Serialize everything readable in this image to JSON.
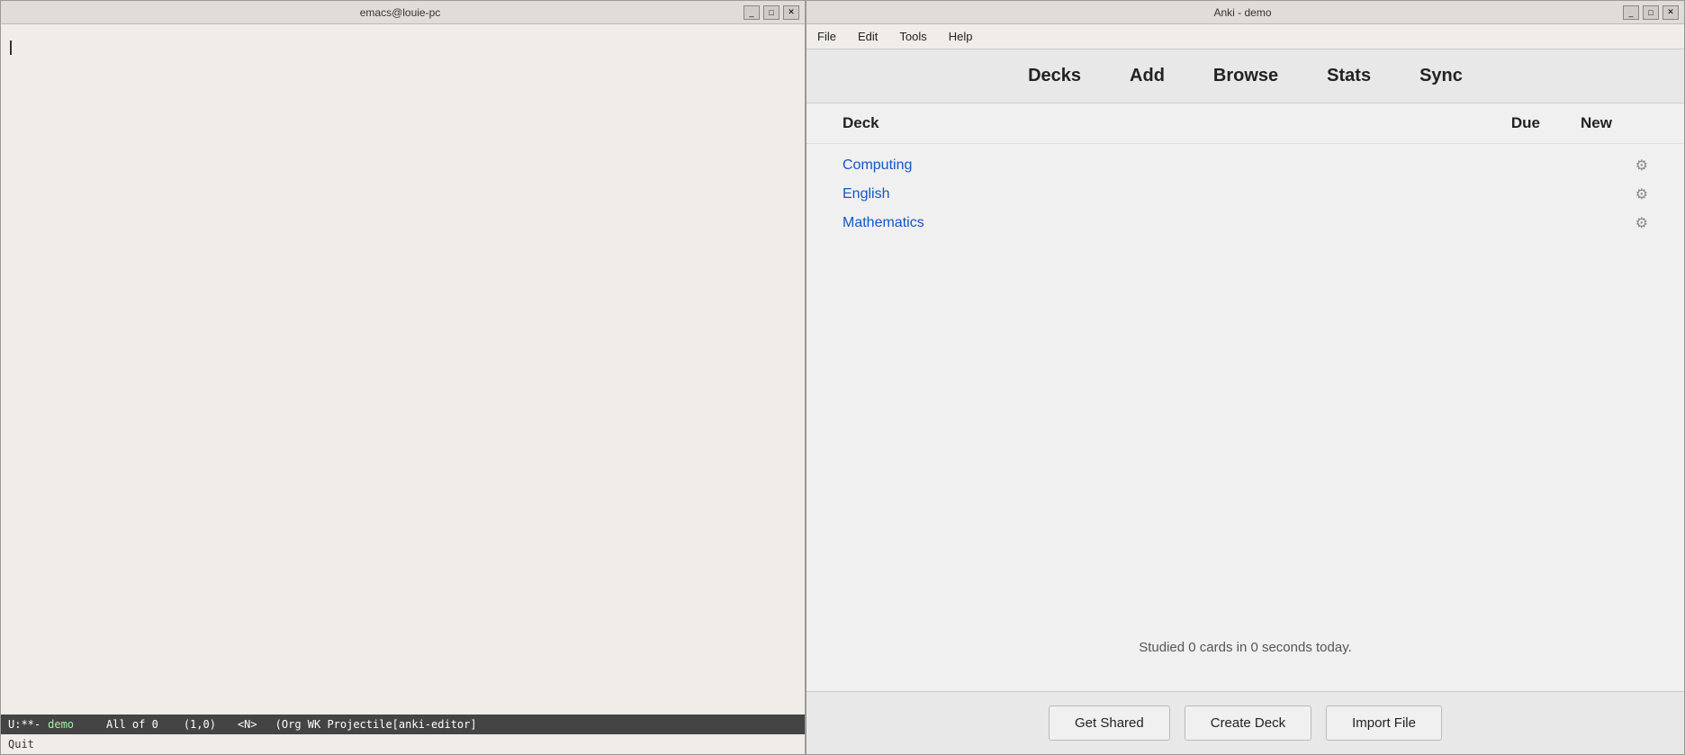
{
  "emacs": {
    "title": "emacs@louie-pc",
    "controls": {
      "minimize": "_",
      "maximize": "□",
      "close": "✕"
    },
    "statusbar": {
      "mode": "U:**-",
      "buffer": "demo",
      "position": "All of 0",
      "lineCol": "(1,0)",
      "mode2": "<N>",
      "modeline": "(Org WK Projectile[anki-editor]"
    },
    "bottom": {
      "text": "Quit"
    }
  },
  "anki": {
    "title": "Anki - demo",
    "controls": {
      "minimize": "_",
      "maximize": "□",
      "close": "✕"
    },
    "menu": {
      "items": [
        "File",
        "Edit",
        "Tools",
        "Help"
      ]
    },
    "toolbar": {
      "buttons": [
        "Decks",
        "Add",
        "Browse",
        "Stats",
        "Sync"
      ]
    },
    "deck_table": {
      "headers": {
        "name": "Deck",
        "due": "Due",
        "new": "New"
      },
      "rows": [
        {
          "name": "Computing",
          "due": "",
          "new": ""
        },
        {
          "name": "English",
          "due": "",
          "new": ""
        },
        {
          "name": "Mathematics",
          "due": "",
          "new": ""
        }
      ]
    },
    "studied": "Studied 0 cards in 0 seconds today.",
    "footer": {
      "get_shared": "Get Shared",
      "create_deck": "Create Deck",
      "import_file": "Import File"
    },
    "statusbar": {
      "of_label": "of"
    }
  }
}
